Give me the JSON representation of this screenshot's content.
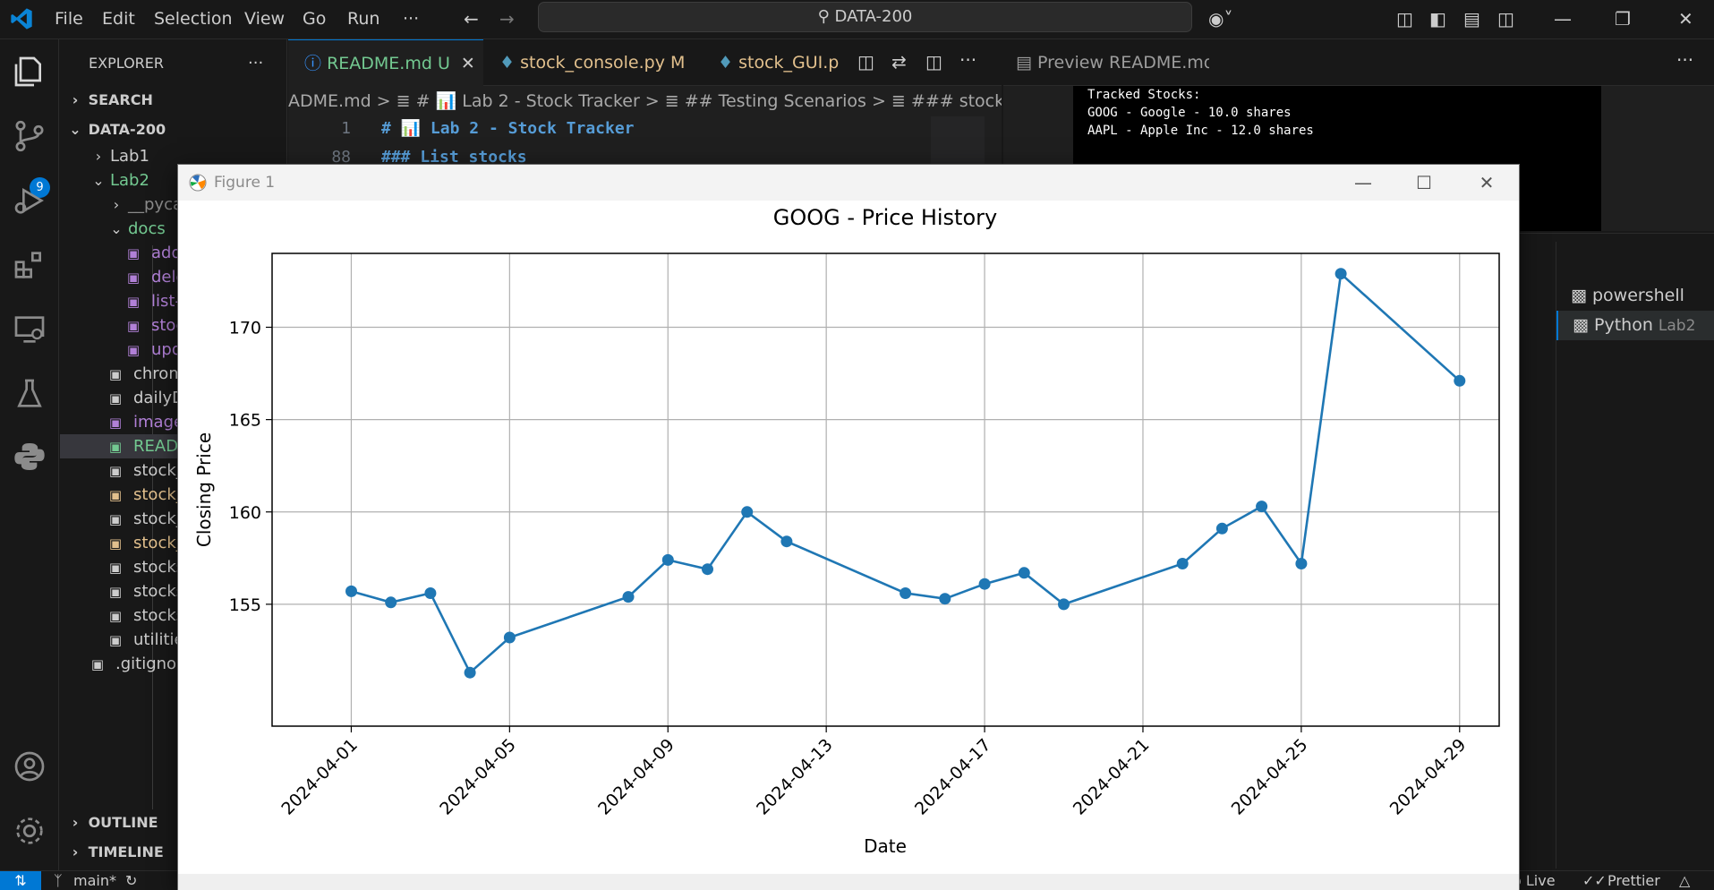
{
  "titlebar": {
    "menu": [
      "File",
      "Edit",
      "Selection",
      "View",
      "Go",
      "Run",
      "···"
    ],
    "command_center": "DATA-200"
  },
  "activitybar": {
    "scm_badge": "9"
  },
  "sidebar": {
    "title": "EXPLORER",
    "more": "···",
    "search_label": "SEARCH",
    "root": "DATA-200",
    "items": [
      {
        "label": "Lab1",
        "color": "#cccccc"
      },
      {
        "label": "Lab2",
        "color": "#73c991"
      },
      {
        "label": "__pycac",
        "color": "#8b8b8b"
      },
      {
        "label": "docs",
        "color": "#73c991"
      },
      {
        "label": "adding",
        "color": "#b180d7"
      },
      {
        "label": "delete",
        "color": "#b180d7"
      },
      {
        "label": "list-sto",
        "color": "#b180d7"
      },
      {
        "label": "stock-",
        "color": "#b180d7"
      },
      {
        "label": "updati",
        "color": "#b180d7"
      },
      {
        "label": "chrome",
        "color": "#cccccc"
      },
      {
        "label": "dailyDa",
        "color": "#cccccc"
      },
      {
        "label": "image.p",
        "color": "#b180d7"
      },
      {
        "label": "READM",
        "color": "#73c991"
      },
      {
        "label": "stock_cl",
        "color": "#cccccc"
      },
      {
        "label": "stock_co",
        "color": "#e2c08d"
      },
      {
        "label": "stock_d",
        "color": "#cccccc"
      },
      {
        "label": "stock_G",
        "color": "#e2c08d"
      },
      {
        "label": "stocks.c",
        "color": "#cccccc"
      },
      {
        "label": "stocks.c",
        "color": "#cccccc"
      },
      {
        "label": "stocks.p",
        "color": "#cccccc"
      },
      {
        "label": "utilities.",
        "color": "#cccccc"
      },
      {
        "label": ".gitignore",
        "color": "#cccccc"
      }
    ],
    "outline_label": "OUTLINE",
    "timeline_label": "TIMELINE"
  },
  "editor": {
    "tabs": [
      {
        "label": "README.md U",
        "color": "#73c991"
      },
      {
        "label": "stock_console.py M",
        "color": "#e2c08d"
      },
      {
        "label": "stock_GUI.p",
        "color": "#e2c08d"
      }
    ],
    "breadcrumb": "ADME.md > ≣ # 📊 Lab 2 - Stock Tracker > ≣ ## Testing Scenarios > ≣ ### stock report",
    "lines": [
      {
        "num": "1",
        "text": "# 📊 Lab 2 - Stock Tracker"
      },
      {
        "num": "88",
        "text": "### List stocks"
      }
    ]
  },
  "preview": {
    "tab_label": "Preview README.md",
    "lines": [
      "Tracked Stocks:",
      "GOOG - Google - 10.0 shares",
      "AAPL - Apple Inc - 12.0 shares"
    ]
  },
  "terminals": [
    {
      "label": "powershell",
      "suffix": ""
    },
    {
      "label": "Python",
      "suffix": "Lab2"
    }
  ],
  "statusbar": {
    "branch": "main*",
    "live": "o Live",
    "prettier": "Prettier"
  },
  "figure": {
    "window_title": "Figure 1"
  },
  "chart_data": {
    "type": "line",
    "title": "GOOG - Price History",
    "xlabel": "Date",
    "ylabel": "Closing Price",
    "color": "#1f77b4",
    "grid": true,
    "xlim": [
      "2024-03-30",
      "2024-04-30"
    ],
    "ylim": [
      148.4,
      174.0
    ],
    "xticks": [
      "2024-04-01",
      "2024-04-05",
      "2024-04-09",
      "2024-04-13",
      "2024-04-17",
      "2024-04-21",
      "2024-04-25",
      "2024-04-29"
    ],
    "yticks": [
      155,
      160,
      165,
      170
    ],
    "points": [
      {
        "x": "2024-04-01",
        "y": 155.7
      },
      {
        "x": "2024-04-02",
        "y": 155.1
      },
      {
        "x": "2024-04-03",
        "y": 155.6
      },
      {
        "x": "2024-04-04",
        "y": 151.3
      },
      {
        "x": "2024-04-05",
        "y": 153.2
      },
      {
        "x": "2024-04-08",
        "y": 155.4
      },
      {
        "x": "2024-04-09",
        "y": 157.4
      },
      {
        "x": "2024-04-10",
        "y": 156.9
      },
      {
        "x": "2024-04-11",
        "y": 160.0
      },
      {
        "x": "2024-04-12",
        "y": 158.4
      },
      {
        "x": "2024-04-15",
        "y": 155.6
      },
      {
        "x": "2024-04-16",
        "y": 155.3
      },
      {
        "x": "2024-04-17",
        "y": 156.1
      },
      {
        "x": "2024-04-18",
        "y": 156.7
      },
      {
        "x": "2024-04-19",
        "y": 155.0
      },
      {
        "x": "2024-04-22",
        "y": 157.2
      },
      {
        "x": "2024-04-23",
        "y": 159.1
      },
      {
        "x": "2024-04-24",
        "y": 160.3
      },
      {
        "x": "2024-04-25",
        "y": 157.2
      },
      {
        "x": "2024-04-26",
        "y": 172.9
      },
      {
        "x": "2024-04-29",
        "y": 167.1
      }
    ]
  }
}
